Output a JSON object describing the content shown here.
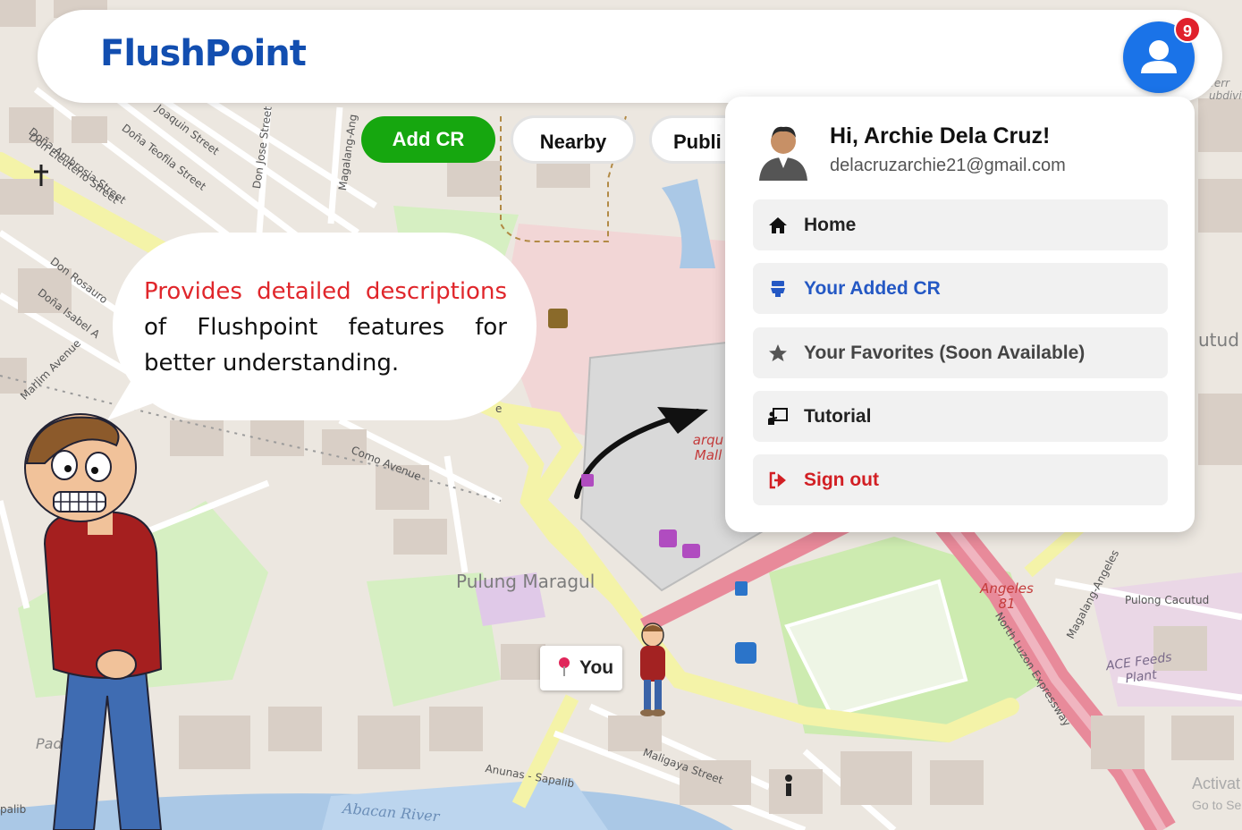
{
  "app": {
    "title": "FlushPoint"
  },
  "header": {
    "notification_count": "9"
  },
  "actions": {
    "add_cr": "Add CR",
    "nearby": "Nearby",
    "public": "Publi"
  },
  "callout": {
    "highlight": "Provides detailed descriptions",
    "rest": "of Flushpoint features for better understanding."
  },
  "user_menu": {
    "greeting": "Hi, Archie Dela Cruz!",
    "email": "delacruzarchie21@gmail.com",
    "items": [
      {
        "label": "Home",
        "icon": "home-icon"
      },
      {
        "label": "Your Added CR",
        "icon": "toilet-icon"
      },
      {
        "label": "Your Favorites (Soon Available)",
        "icon": "star-icon"
      },
      {
        "label": "Tutorial",
        "icon": "tutorial-icon"
      },
      {
        "label": "Sign out",
        "icon": "sign-out-icon"
      }
    ]
  },
  "map": {
    "you_label": "You",
    "labels": {
      "dona_ambrosia": "Doña Ambrosia Street",
      "joaquin": "Joaquin Street",
      "dona_teofila": "Doña Teofila Street",
      "don_jose": "Don Jose Street",
      "magalang_ang": "Magalang-Ang",
      "don_eleuterio": "Don Eleuterio Street",
      "don_rosauro": "Don Rosauro",
      "dona_isabel": "Doña Isabel A",
      "marlim": "Marlim Avenue",
      "como": "Como Avenue",
      "pulung_maragul": "Pulung Maragul",
      "maligaya": "Maligaya Street",
      "anunas": "Anunas - Sapalib",
      "abacan": "Abacan River",
      "pulong_cacutud": "Pulong Cacutud",
      "magalang_angeles": "Magalang-Angeles",
      "nlex": "North Luzon Expressway",
      "angeles81": "Angeles 81",
      "ace_feeds": "ACE Feeds Plant",
      "marquee": "arqu Mall",
      "pader": "Pader",
      "sapalib": "palib",
      "terr": "Terr ubdivi",
      "cutud": "utud",
      "e_label": "e"
    }
  },
  "watermark": {
    "line1": "Activat",
    "line2": "Go to Se"
  },
  "colors": {
    "brand": "#124eb0",
    "accent_blue": "#1a73e8",
    "add_green": "#16a70f",
    "badge_red": "#e0212c",
    "signout_red": "#d21f24"
  }
}
